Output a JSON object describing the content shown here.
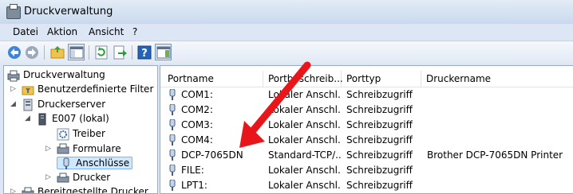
{
  "window": {
    "title": "Druckverwaltung"
  },
  "menu": [
    "Datei",
    "Aktion",
    "Ansicht",
    "?"
  ],
  "toolbar": {
    "icons": [
      "back-icon",
      "forward-icon",
      "up-folder-icon",
      "show-hide-tree-icon",
      "refresh-icon",
      "export-list-icon",
      "help-icon",
      "show-action-pane-icon"
    ]
  },
  "tree": {
    "root": "Druckverwaltung",
    "filters": "Benutzerdefinierte Filter",
    "servers": "Druckerserver",
    "server": "E007 (lokal)",
    "drivers": "Treiber",
    "forms": "Formulare",
    "ports": "Anschlüsse",
    "printers": "Drucker",
    "deployed": "Bereitgestellte Drucker"
  },
  "table": {
    "columns": [
      "Portname",
      "Portbeschreib...",
      "Porttyp",
      "Druckername"
    ],
    "rows": [
      {
        "name": "COM1:",
        "desc": "Lokaler Anschl...",
        "type": "Schreibzugriff",
        "printer": ""
      },
      {
        "name": "COM2:",
        "desc": "Lokaler Anschl...",
        "type": "Schreibzugriff",
        "printer": ""
      },
      {
        "name": "COM3:",
        "desc": "Lokaler Anschl...",
        "type": "Schreibzugriff",
        "printer": ""
      },
      {
        "name": "COM4:",
        "desc": "Lokaler Anschl...",
        "type": "Schreibzugriff",
        "printer": ""
      },
      {
        "name": "DCP-7065DN",
        "desc": "Standard-TCP/...",
        "type": "Schreibzugriff",
        "printer": "Brother DCP-7065DN Printer"
      },
      {
        "name": "FILE:",
        "desc": "Lokaler Anschl...",
        "type": "Schreibzugriff",
        "printer": ""
      },
      {
        "name": "LPT1:",
        "desc": "Lokaler Anschl...",
        "type": "Schreibzugriff",
        "printer": ""
      }
    ]
  },
  "annotation": {
    "arrow_color": "#e8161b"
  }
}
